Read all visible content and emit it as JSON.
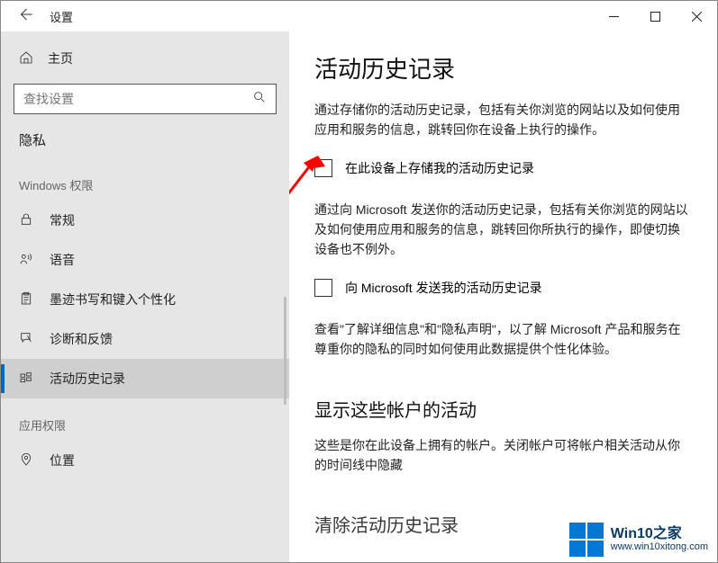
{
  "titlebar": {
    "title": "设置"
  },
  "sidebar": {
    "home": "主页",
    "search_placeholder": "查找设置",
    "section": "隐私",
    "group_windows": "Windows 权限",
    "group_app": "应用权限",
    "items": [
      {
        "label": "常规"
      },
      {
        "label": "语音"
      },
      {
        "label": "墨迹书写和键入个性化"
      },
      {
        "label": "诊断和反馈"
      },
      {
        "label": "活动历史记录"
      },
      {
        "label": "位置"
      }
    ]
  },
  "content": {
    "title": "活动历史记录",
    "intro": "通过存储你的活动历史记录，包括有关你浏览的网站以及如何使用应用和服务的信息，跳转回你在设备上执行的操作。",
    "checkbox1": "在此设备上存储我的活动历史记录",
    "para2": "通过向 Microsoft 发送你的活动历史记录，包括有关你浏览的网站以及如何使用应用和服务的信息，跳转回你所执行的操作，即使切换设备也不例外。",
    "checkbox2": "向 Microsoft 发送我的活动历史记录",
    "para3": "查看\"了解详细信息\"和\"隐私声明\"，以了解 Microsoft 产品和服务在尊重你的隐私的同时如何使用此数据提供个性化体验。",
    "section2_title": "显示这些帐户的活动",
    "section2_para": "这些是你在此设备上拥有的帐户。关闭帐户可将帐户相关活动从你的时间线中隐藏",
    "section3_partial": "清除活动历史记录"
  },
  "watermark": {
    "title": "Win10之家",
    "url": "www.win10xitong.com"
  }
}
